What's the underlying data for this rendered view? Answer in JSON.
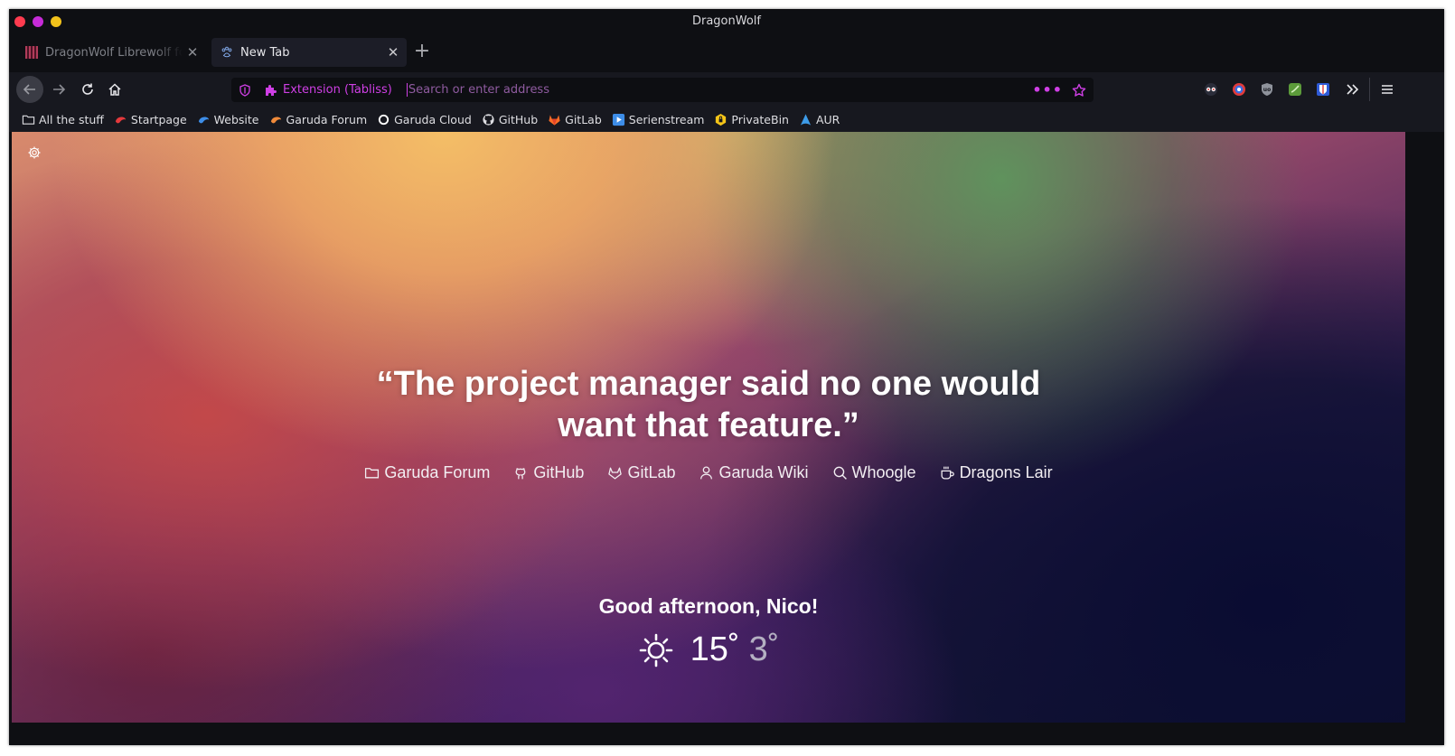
{
  "window": {
    "title": "DragonWolf"
  },
  "tabs": [
    {
      "title": "DragonWolf Librewolf fork",
      "active": false
    },
    {
      "title": "New Tab",
      "active": true
    }
  ],
  "urlbar": {
    "extension_label": "Extension (Tabliss)",
    "placeholder": "Search or enter address",
    "value": ""
  },
  "bookmarks": [
    {
      "label": "All the stuff",
      "icon": "folder-icon"
    },
    {
      "label": "Startpage",
      "icon": "startpage-icon"
    },
    {
      "label": "Website",
      "icon": "website-icon"
    },
    {
      "label": "Garuda Forum",
      "icon": "garuda-icon"
    },
    {
      "label": "Garuda Cloud",
      "icon": "cloud-icon"
    },
    {
      "label": "GitHub",
      "icon": "github-icon"
    },
    {
      "label": "GitLab",
      "icon": "gitlab-icon"
    },
    {
      "label": "Serienstream",
      "icon": "play-icon"
    },
    {
      "label": "PrivateBin",
      "icon": "privatebin-icon"
    },
    {
      "label": "AUR",
      "icon": "arch-icon"
    }
  ],
  "newtab": {
    "quote": "“The project manager said no one would want that feature.”",
    "quote_line1": "“The project manager said no one would",
    "quote_line2": "want that feature.”",
    "quick_links": [
      {
        "label": "Garuda Forum",
        "icon": "folder-icon"
      },
      {
        "label": "GitHub",
        "icon": "github-icon"
      },
      {
        "label": "GitLab",
        "icon": "gitlab-icon"
      },
      {
        "label": "Garuda Wiki",
        "icon": "user-icon"
      },
      {
        "label": "Whoogle",
        "icon": "search-icon"
      },
      {
        "label": "Dragons Lair",
        "icon": "coffee-icon"
      }
    ],
    "greeting": "Good afternoon, Nico!",
    "weather": {
      "icon": "sun-icon",
      "high": "15˚",
      "low": "3˚"
    }
  },
  "colors": {
    "accent": "#cf3fe5",
    "window_bg": "#0e0f13",
    "toolbar_bg": "#17181f",
    "active_tab_bg": "#1c1d27"
  }
}
